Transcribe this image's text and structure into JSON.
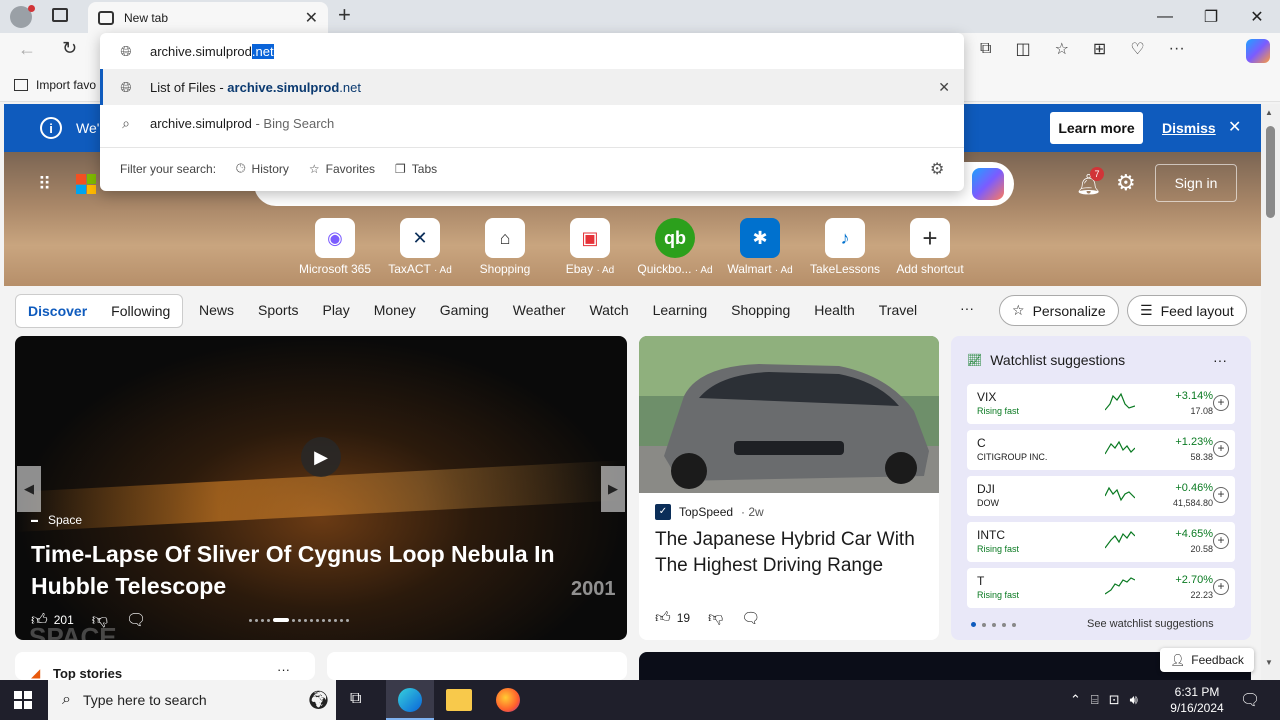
{
  "browser": {
    "tab_title": "New tab",
    "address_value": "archive.simulprod",
    "address_selected": ".net",
    "favorites_import": "Import favo"
  },
  "dropdown": {
    "suggestions": [
      {
        "prefix": "List of Files - ",
        "bold": "archive.simulprod",
        "suffix": ".net"
      },
      {
        "text": "archive.simulprod",
        "hint": " - Bing Search"
      }
    ],
    "filter_label": "Filter your search:",
    "filters": [
      "History",
      "Favorites",
      "Tabs"
    ]
  },
  "infobar": {
    "text": "We'",
    "learn_more": "Learn more",
    "dismiss": "Dismiss"
  },
  "ntp": {
    "sign_in": "Sign in",
    "notification_count": "7",
    "shortcuts": [
      {
        "label": "Microsoft 365",
        "ad": ""
      },
      {
        "label": "TaxACT",
        "ad": "· Ad"
      },
      {
        "label": "Shopping",
        "ad": ""
      },
      {
        "label": "Ebay",
        "ad": "· Ad"
      },
      {
        "label": "Quickbo...",
        "ad": "· Ad"
      },
      {
        "label": "Walmart",
        "ad": "· Ad"
      },
      {
        "label": "TakeLessons",
        "ad": ""
      },
      {
        "label": "Add shortcut",
        "ad": ""
      }
    ]
  },
  "nav": {
    "discover": "Discover",
    "following": "Following",
    "items": [
      "News",
      "Sports",
      "Play",
      "Money",
      "Gaming",
      "Weather",
      "Watch",
      "Learning",
      "Shopping",
      "Health",
      "Travel"
    ],
    "more": "···",
    "personalize": "Personalize",
    "feed_layout": "Feed layout"
  },
  "hero": {
    "source": "Space",
    "title": "Time-Lapse Of Sliver Of Cygnus Loop Nebula In Hubble Telescope",
    "year": "2001",
    "likes": "201",
    "watermark": "SPACE"
  },
  "car": {
    "source": "TopSpeed",
    "age": "· 2w",
    "title": "The Japanese Hybrid Car With The Highest Driving Range",
    "likes": "19"
  },
  "watchlist": {
    "title": "Watchlist suggestions",
    "more": "···",
    "see_more": "See watchlist suggestions",
    "rows": [
      {
        "symbol": "VIX",
        "sub": "Rising fast",
        "pct": "+3.14%",
        "price": "17.08"
      },
      {
        "symbol": "C",
        "sub": "CITIGROUP INC.",
        "pct": "+1.23%",
        "price": "58.38"
      },
      {
        "symbol": "DJI",
        "sub": "DOW",
        "pct": "+0.46%",
        "price": "41,584.80"
      },
      {
        "symbol": "INTC",
        "sub": "Rising fast",
        "pct": "+4.65%",
        "price": "20.58"
      },
      {
        "symbol": "T",
        "sub": "Rising fast",
        "pct": "+2.70%",
        "price": "22.23"
      }
    ]
  },
  "lower": {
    "top_stories": "Top stories",
    "feedback": "Feedback"
  },
  "taskbar": {
    "search_placeholder": "Type here to search",
    "time": "6:31 PM",
    "date": "9/16/2024"
  },
  "colors": {
    "accent": "#0f5bbd",
    "positive": "#0a7a22",
    "link": "#0f5bbd"
  }
}
